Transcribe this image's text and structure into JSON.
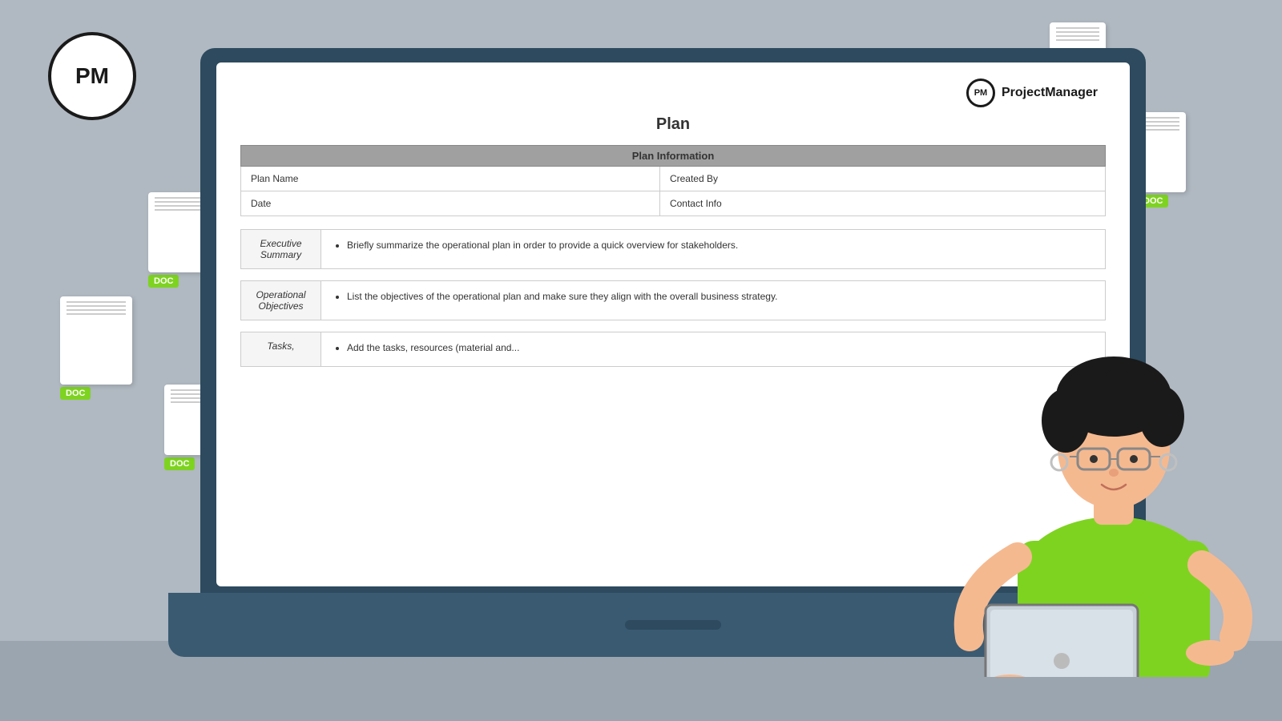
{
  "logo": {
    "text": "PM"
  },
  "docs": [
    {
      "id": "doc1",
      "badge": "DOC"
    },
    {
      "id": "doc2",
      "badge": "DOC"
    },
    {
      "id": "doc3",
      "badge": "DOC"
    },
    {
      "id": "doc4",
      "badge": "DOC"
    },
    {
      "id": "doc5",
      "badge": "DOC"
    }
  ],
  "brand": {
    "circle_text": "PM",
    "name": "ProjectManager"
  },
  "document": {
    "title": "Plan",
    "plan_info_header": "Plan Information",
    "fields": {
      "plan_name": "Plan Name",
      "created_by": "Created By",
      "date": "Date",
      "contact_info": "Contact Info"
    },
    "sections": [
      {
        "label": "Executive\nSummary",
        "content": "Briefly summarize the operational plan in order to provide a quick overview for stakeholders."
      },
      {
        "label": "Operational\nObjectives",
        "content": "List the objectives of the operational plan and make sure they align with the overall business strategy."
      },
      {
        "label": "Tasks,",
        "content": "Add the tasks, resources (material and..."
      }
    ]
  },
  "colors": {
    "accent_green": "#7ed321",
    "dark_bg": "#2d4a5e",
    "gray_bg": "#b0b8c1"
  }
}
